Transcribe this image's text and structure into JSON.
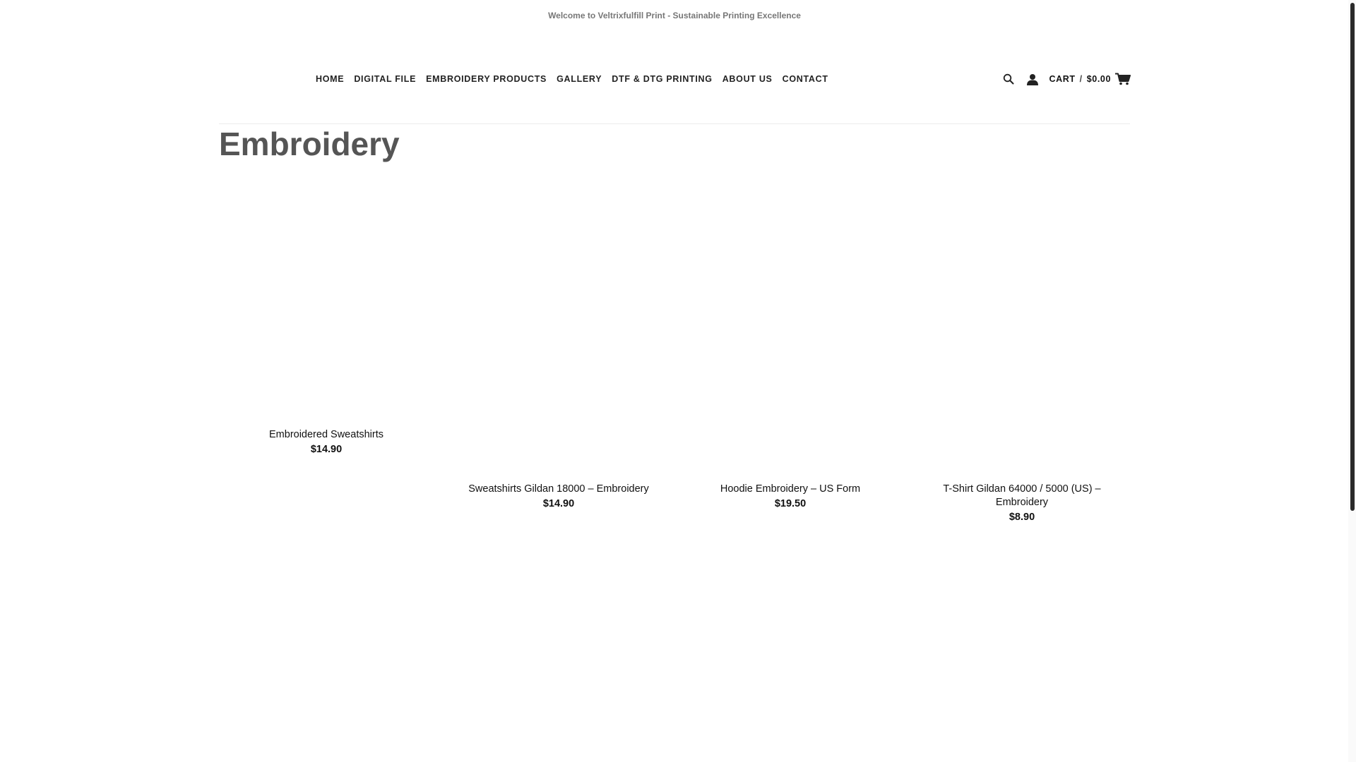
{
  "topbar": {
    "welcome_text": "Welcome to Veltrixfulfill Print - Sustainable Printing Excellence"
  },
  "nav": {
    "items": [
      {
        "label": "HOME"
      },
      {
        "label": "DIGITAL FILE"
      },
      {
        "label": "EMBROIDERY PRODUCTS"
      },
      {
        "label": "GALLERY"
      },
      {
        "label": "DTF & DTG PRINTING"
      },
      {
        "label": "ABOUT US"
      },
      {
        "label": "CONTACT"
      }
    ]
  },
  "header_tools": {
    "search_icon": "search-icon",
    "account_icon": "user-icon",
    "cart_label": "CART",
    "cart_separator": "/",
    "cart_total": "$0.00",
    "cart_icon": "shopping-cart-icon"
  },
  "page": {
    "title": "Embroidery"
  },
  "products": [
    {
      "name": "Embroidered Sweatshirts",
      "price": "$14.90"
    },
    {
      "name": "Sweatshirts Gildan 18000 – Embroidery",
      "price": "$14.90"
    },
    {
      "name": "Hoodie Embroidery – US Form",
      "price": "$19.50"
    },
    {
      "name": "T-Shirt Gildan 64000 / 5000 (US) – Embroidery",
      "price": "$8.90"
    }
  ]
}
